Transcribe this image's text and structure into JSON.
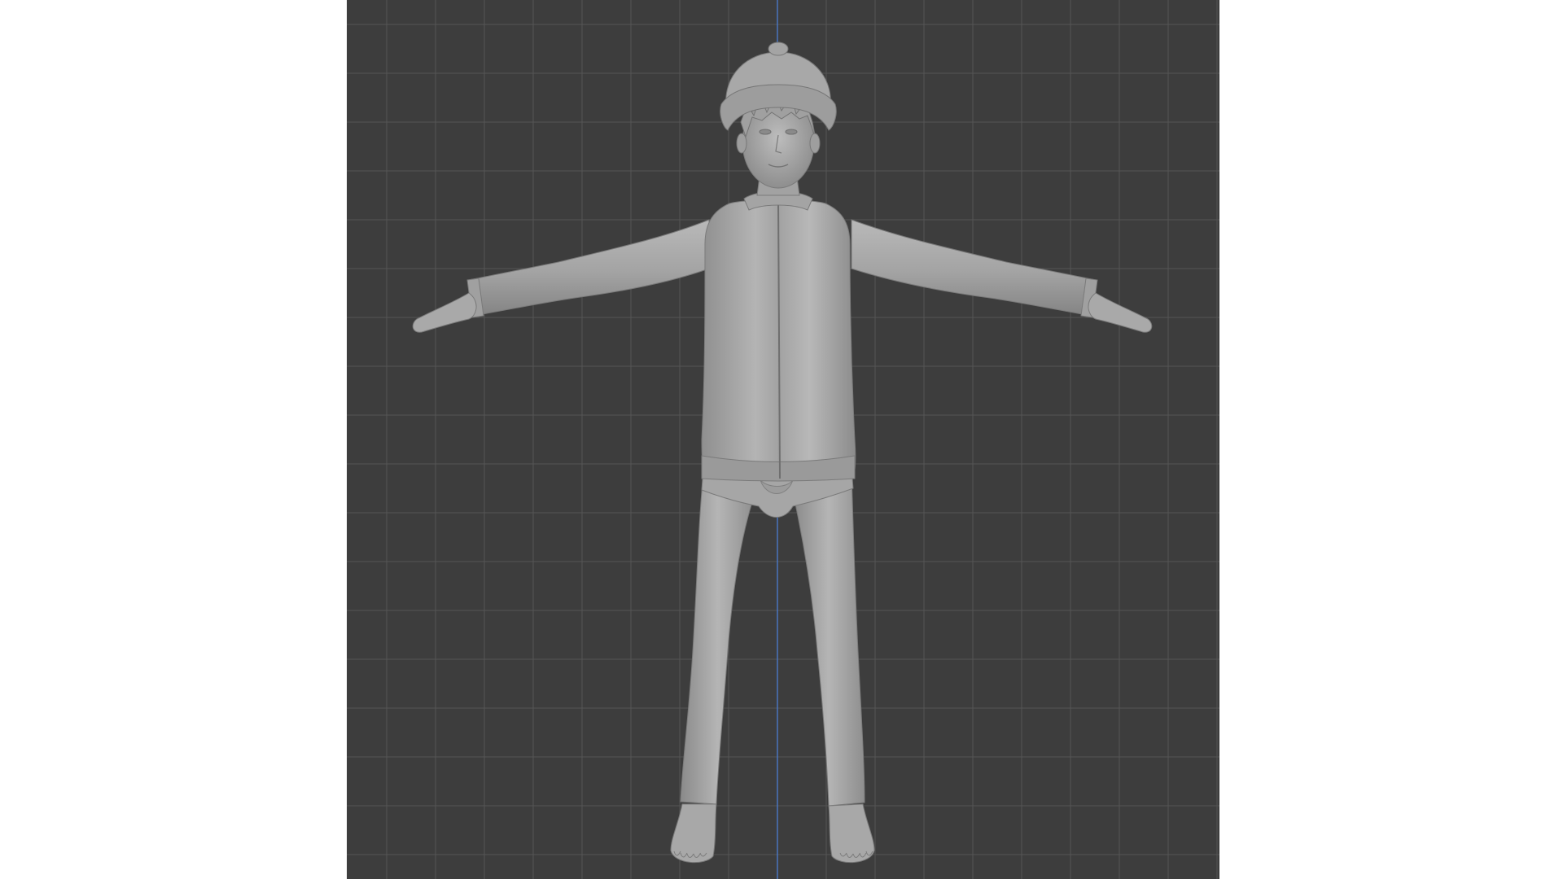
{
  "viewport": {
    "background_color": "#3d3d3d",
    "grid_minor_color": "#4a4a4a",
    "grid_major_color": "#555555",
    "axis_z_color": "#4a78c8",
    "model_color": "#a9a9a9",
    "model_shadow_color": "#7d7d7d",
    "model_highlight_color": "#c4c4c4",
    "grid_visible": true,
    "vertical_axis": "z",
    "view": "front-orthographic",
    "shading": "solid",
    "subject": "t-pose-character"
  }
}
